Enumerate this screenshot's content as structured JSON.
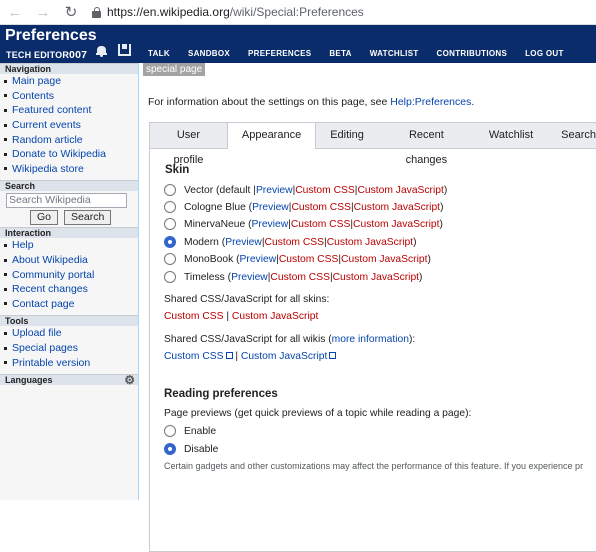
{
  "browser": {
    "back_icon": "arrow-left-icon",
    "forward_icon": "arrow-right-icon",
    "reload_icon": "reload-icon",
    "url_host": "https://en.wikipedia.org",
    "url_path": "/wiki/Special:Preferences"
  },
  "header": {
    "title": "Preferences",
    "user_prefix": "TECH EDITOR",
    "user_suffix": "007",
    "tabs": [
      "TALK",
      "SANDBOX",
      "PREFERENCES",
      "BETA",
      "WATCHLIST",
      "CONTRIBUTIONS",
      "LOG OUT"
    ],
    "bg": "#0a2c6b"
  },
  "sidebar": {
    "navigation_title": "Navigation",
    "navigation": [
      "Main page",
      "Contents",
      "Featured content",
      "Current events",
      "Random article",
      "Donate to Wikipedia",
      "Wikipedia store"
    ],
    "search_title": "Search",
    "search_placeholder": "Search Wikipedia",
    "go_label": "Go",
    "search_label": "Search",
    "interaction_title": "Interaction",
    "interaction": [
      "Help",
      "About Wikipedia",
      "Community portal",
      "Recent changes",
      "Contact page"
    ],
    "tools_title": "Tools",
    "tools": [
      "Upload file",
      "Special pages",
      "Printable version"
    ],
    "languages_title": "Languages"
  },
  "main": {
    "special_label": "special page",
    "intro_text": "For information about the settings on this page, see ",
    "intro_link": "Help:Preferences",
    "intro_end": ".",
    "tabs": [
      "User profile",
      "Appearance",
      "Editing",
      "Recent changes",
      "Watchlist",
      "Search"
    ],
    "skin_heading": "Skin",
    "skins": [
      {
        "name": "Vector (default | ",
        "selected": false
      },
      {
        "name": "Cologne Blue (",
        "selected": false
      },
      {
        "name": "MinervaNeue (",
        "selected": false
      },
      {
        "name": "Modern (",
        "selected": true
      },
      {
        "name": "MonoBook (",
        "selected": false
      },
      {
        "name": "Timeless (",
        "selected": false
      }
    ],
    "preview": "Preview",
    "sep": " | ",
    "custom_css": "Custom CSS",
    "custom_js": "Custom JavaScript",
    "close": ")",
    "shared_skins_label": "Shared CSS/JavaScript for all skins:",
    "shared_wikis_label": "Shared CSS/JavaScript for all wikis (",
    "more_info": "more information",
    "shared_wikis_end": "):",
    "reading_heading": "Reading preferences",
    "previews_label": "Page previews (get quick previews of a topic while reading a page):",
    "enable_label": "Enable",
    "disable_label": "Disable",
    "enable_selected": false,
    "disable_selected": true,
    "note": "Certain gadgets and other customizations may affect the performance of this feature. If you experience pr"
  }
}
